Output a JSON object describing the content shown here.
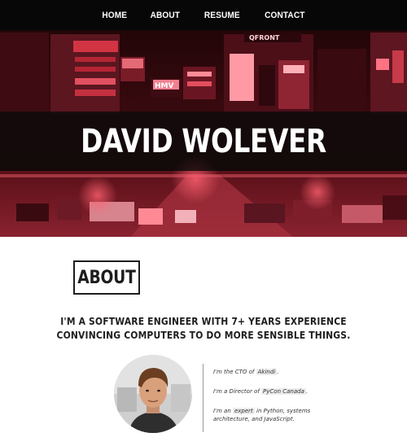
{
  "nav": {
    "items": [
      {
        "label": "HOME"
      },
      {
        "label": "ABOUT"
      },
      {
        "label": "RESUME"
      },
      {
        "label": "CONTACT"
      }
    ]
  },
  "hero": {
    "title": "DAVID WOLEVER",
    "signs": [
      "QFRONT",
      "HMV"
    ],
    "tint_color": "#c21a2a",
    "band_color": "#0a0a0a"
  },
  "about": {
    "heading": "ABOUT",
    "tagline_line1": "I'M A SOFTWARE ENGINEER WITH 7+ YEARS EXPERIENCE",
    "tagline_line2": "CONVINCING COMPUTERS TO DO MORE SENSIBLE THINGS.",
    "facts": [
      {
        "pre": "I'm the CTO of ",
        "highlight": "Akindi",
        "post": "."
      },
      {
        "pre": "I'm a Director of ",
        "highlight": "PyCon Canada",
        "post": "."
      },
      {
        "pre": "I'm an ",
        "highlight": "expert",
        "post": " in Python, systems architecture, and JavaScript."
      }
    ]
  }
}
